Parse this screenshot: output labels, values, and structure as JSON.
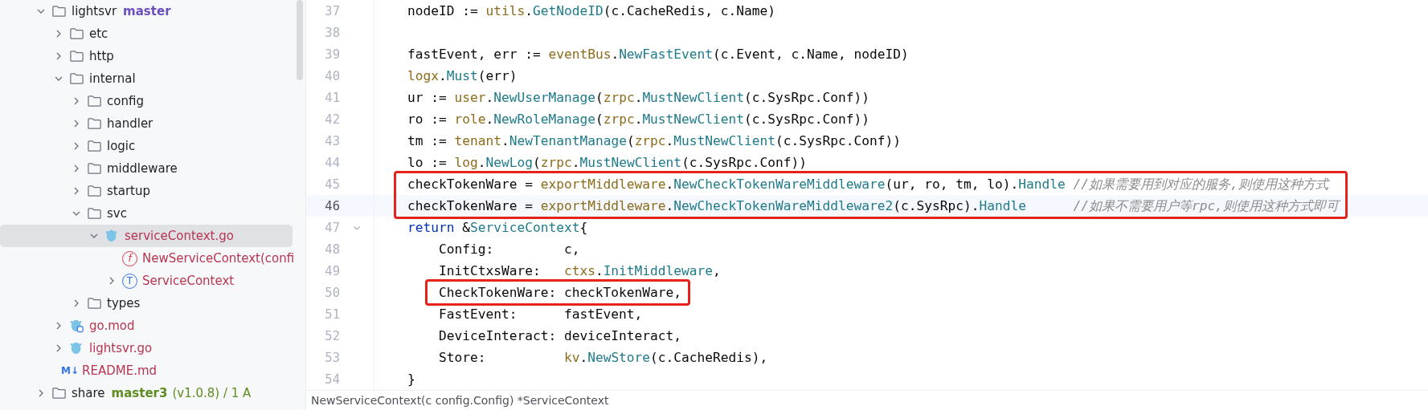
{
  "project_tree": [
    {
      "name": "lightsvr",
      "kind": "folder",
      "expanded": true,
      "selected": false,
      "modified": false,
      "branch": "master",
      "color": "#6b4fbb",
      "children": [
        {
          "name": "etc",
          "kind": "folder",
          "expanded": false,
          "selected": false,
          "modified": false
        },
        {
          "name": "http",
          "kind": "folder",
          "expanded": false,
          "selected": false,
          "modified": false
        },
        {
          "name": "internal",
          "kind": "folder",
          "expanded": true,
          "selected": false,
          "modified": false,
          "children": [
            {
              "name": "config",
              "kind": "folder",
              "expanded": false,
              "selected": false,
              "modified": false
            },
            {
              "name": "handler",
              "kind": "folder",
              "expanded": false,
              "selected": false,
              "modified": false
            },
            {
              "name": "logic",
              "kind": "folder",
              "expanded": false,
              "selected": false,
              "modified": false
            },
            {
              "name": "middleware",
              "kind": "folder",
              "expanded": false,
              "selected": false,
              "modified": false
            },
            {
              "name": "startup",
              "kind": "folder",
              "expanded": false,
              "selected": false,
              "modified": false
            },
            {
              "name": "svc",
              "kind": "folder",
              "expanded": true,
              "selected": false,
              "modified": false,
              "children": [
                {
                  "name": "serviceContext.go",
                  "kind": "go",
                  "expanded": true,
                  "selected": true,
                  "modified": true,
                  "children": [
                    {
                      "name": "NewServiceContext(confi",
                      "kind": "function",
                      "glyph": "f",
                      "selected": false,
                      "modified": true
                    },
                    {
                      "name": "ServiceContext",
                      "kind": "type",
                      "glyph": "T",
                      "expanded": false,
                      "selected": false,
                      "modified": true
                    }
                  ]
                }
              ]
            },
            {
              "name": "types",
              "kind": "folder",
              "expanded": false,
              "selected": false,
              "modified": false
            }
          ]
        },
        {
          "name": "go.mod",
          "kind": "gomod",
          "expanded": false,
          "selected": false,
          "modified": true
        },
        {
          "name": "lightsvr.go",
          "kind": "go",
          "expanded": false,
          "selected": false,
          "modified": true
        },
        {
          "name": "README.md",
          "kind": "markdown",
          "badge": "M↓",
          "selected": false,
          "modified": true
        }
      ]
    },
    {
      "name": "share",
      "kind": "folder",
      "expanded": false,
      "selected": false,
      "modified": false,
      "branch": "master3",
      "color": "#5f8c1e",
      "info": "(v1.0.8) / 1 A"
    }
  ],
  "editor": {
    "lines": [
      {
        "number": "37",
        "current": false,
        "boxed": false,
        "nested": false,
        "tokens": [
          {
            "text": "nodeID := ",
            "kind": "plain"
          },
          {
            "text": "utils",
            "kind": "package"
          },
          {
            "text": ".",
            "kind": "plain"
          },
          {
            "text": "GetNodeID",
            "kind": "call"
          },
          {
            "text": "(c.CacheRedis, c.Name)",
            "kind": "plain"
          }
        ]
      },
      {
        "number": "38",
        "current": false,
        "boxed": false
      },
      {
        "number": "39",
        "current": false,
        "boxed": false,
        "nested": false,
        "tokens": [
          {
            "text": "fastEvent, err := ",
            "kind": "plain"
          },
          {
            "text": "eventBus",
            "kind": "package"
          },
          {
            "text": ".",
            "kind": "plain"
          },
          {
            "text": "NewFastEvent",
            "kind": "call"
          },
          {
            "text": "(c.Event, c.Name, nodeID)",
            "kind": "plain"
          }
        ]
      },
      {
        "number": "40",
        "current": false,
        "boxed": false,
        "nested": false,
        "tokens": [
          {
            "text": "logx",
            "kind": "package"
          },
          {
            "text": ".",
            "kind": "plain"
          },
          {
            "text": "Must",
            "kind": "call"
          },
          {
            "text": "(err)",
            "kind": "plain"
          }
        ]
      },
      {
        "number": "41",
        "current": false,
        "boxed": false,
        "nested": false,
        "tokens": [
          {
            "text": "ur := ",
            "kind": "plain"
          },
          {
            "text": "user",
            "kind": "package"
          },
          {
            "text": ".",
            "kind": "plain"
          },
          {
            "text": "NewUserManage",
            "kind": "call"
          },
          {
            "text": "(",
            "kind": "plain"
          },
          {
            "text": "zrpc",
            "kind": "package"
          },
          {
            "text": ".",
            "kind": "plain"
          },
          {
            "text": "MustNewClient",
            "kind": "call"
          },
          {
            "text": "(c.SysRpc.Conf))",
            "kind": "plain"
          }
        ]
      },
      {
        "number": "42",
        "current": false,
        "boxed": false,
        "nested": false,
        "tokens": [
          {
            "text": "ro := ",
            "kind": "plain"
          },
          {
            "text": "role",
            "kind": "package"
          },
          {
            "text": ".",
            "kind": "plain"
          },
          {
            "text": "NewRoleManage",
            "kind": "call"
          },
          {
            "text": "(",
            "kind": "plain"
          },
          {
            "text": "zrpc",
            "kind": "package"
          },
          {
            "text": ".",
            "kind": "plain"
          },
          {
            "text": "MustNewClient",
            "kind": "call"
          },
          {
            "text": "(c.SysRpc.Conf))",
            "kind": "plain"
          }
        ]
      },
      {
        "number": "43",
        "current": false,
        "boxed": false,
        "nested": false,
        "tokens": [
          {
            "text": "tm := ",
            "kind": "plain"
          },
          {
            "text": "tenant",
            "kind": "package"
          },
          {
            "text": ".",
            "kind": "plain"
          },
          {
            "text": "NewTenantManage",
            "kind": "call"
          },
          {
            "text": "(",
            "kind": "plain"
          },
          {
            "text": "zrpc",
            "kind": "package"
          },
          {
            "text": ".",
            "kind": "plain"
          },
          {
            "text": "MustNewClient",
            "kind": "call"
          },
          {
            "text": "(c.SysRpc.Conf))",
            "kind": "plain"
          }
        ]
      },
      {
        "number": "44",
        "current": false,
        "boxed": false,
        "nested": false,
        "tokens": [
          {
            "text": "lo := ",
            "kind": "plain"
          },
          {
            "text": "log",
            "kind": "package"
          },
          {
            "text": ".",
            "kind": "plain"
          },
          {
            "text": "NewLog",
            "kind": "call"
          },
          {
            "text": "(",
            "kind": "plain"
          },
          {
            "text": "zrpc",
            "kind": "package"
          },
          {
            "text": ".",
            "kind": "plain"
          },
          {
            "text": "MustNewClient",
            "kind": "call"
          },
          {
            "text": "(c.SysRpc.Conf))",
            "kind": "plain"
          }
        ]
      },
      {
        "number": "45",
        "current": false,
        "boxed": true,
        "nested": false,
        "tokens": [
          {
            "text": "checkTokenWare = ",
            "kind": "plain"
          },
          {
            "text": "exportMiddleware",
            "kind": "package"
          },
          {
            "text": ".",
            "kind": "plain"
          },
          {
            "text": "NewCheckTokenWareMiddleware",
            "kind": "call"
          },
          {
            "text": "(ur, ro, tm, lo).",
            "kind": "plain"
          },
          {
            "text": "Handle",
            "kind": "call"
          },
          {
            "text": " //如果需要用到对应的服务,则使用这种方式",
            "kind": "comment"
          }
        ]
      },
      {
        "number": "46",
        "current": true,
        "boxed": true,
        "nested": false,
        "tokens": [
          {
            "text": "checkTokenWare = ",
            "kind": "plain"
          },
          {
            "text": "exportMiddleware",
            "kind": "package"
          },
          {
            "text": ".",
            "kind": "plain"
          },
          {
            "text": "NewCheckTokenWareMiddleware2",
            "kind": "call"
          },
          {
            "text": "(c.SysRpc).",
            "kind": "plain"
          },
          {
            "text": "Handle",
            "kind": "call"
          },
          {
            "text": "      //如果不需要用户等rpc,则使用这种方式即可",
            "kind": "comment"
          }
        ]
      },
      {
        "number": "47",
        "current": false,
        "boxed": false,
        "nested": false,
        "foldable": true,
        "tokens": [
          {
            "text": "return",
            "kind": "keyword"
          },
          {
            "text": " &",
            "kind": "plain"
          },
          {
            "text": "ServiceContext",
            "kind": "call"
          },
          {
            "text": "{",
            "kind": "plain"
          }
        ]
      },
      {
        "number": "48",
        "current": false,
        "boxed": false,
        "nested": true,
        "tokens": [
          {
            "text": "Config:         c,",
            "kind": "plain"
          }
        ]
      },
      {
        "number": "49",
        "current": false,
        "boxed": false,
        "nested": true,
        "tokens": [
          {
            "text": "InitCtxsWare:   ",
            "kind": "plain"
          },
          {
            "text": "ctxs",
            "kind": "package"
          },
          {
            "text": ".",
            "kind": "plain"
          },
          {
            "text": "InitMiddleware",
            "kind": "call"
          },
          {
            "text": ",",
            "kind": "plain"
          }
        ]
      },
      {
        "number": "50",
        "current": false,
        "boxed": true,
        "nested": true,
        "tokens": [
          {
            "text": "CheckTokenWare: checkTokenWare,",
            "kind": "plain"
          }
        ]
      },
      {
        "number": "51",
        "current": false,
        "boxed": false,
        "nested": true,
        "tokens": [
          {
            "text": "FastEvent:      fastEvent,",
            "kind": "plain"
          }
        ]
      },
      {
        "number": "52",
        "current": false,
        "boxed": false,
        "nested": true,
        "tokens": [
          {
            "text": "DeviceInteract: deviceInteract,",
            "kind": "plain"
          }
        ]
      },
      {
        "number": "53",
        "current": false,
        "boxed": false,
        "nested": true,
        "tokens": [
          {
            "text": "Store:          ",
            "kind": "plain"
          },
          {
            "text": "kv",
            "kind": "package"
          },
          {
            "text": ".",
            "kind": "plain"
          },
          {
            "text": "NewStore",
            "kind": "call"
          },
          {
            "text": "(c.CacheRedis),",
            "kind": "plain"
          }
        ]
      },
      {
        "number": "54",
        "current": false,
        "boxed": false,
        "nested": false,
        "tokens": [
          {
            "text": "}",
            "kind": "plain"
          }
        ]
      }
    ],
    "breadcrumb": "NewServiceContext(c config.Config) *ServiceContext"
  }
}
